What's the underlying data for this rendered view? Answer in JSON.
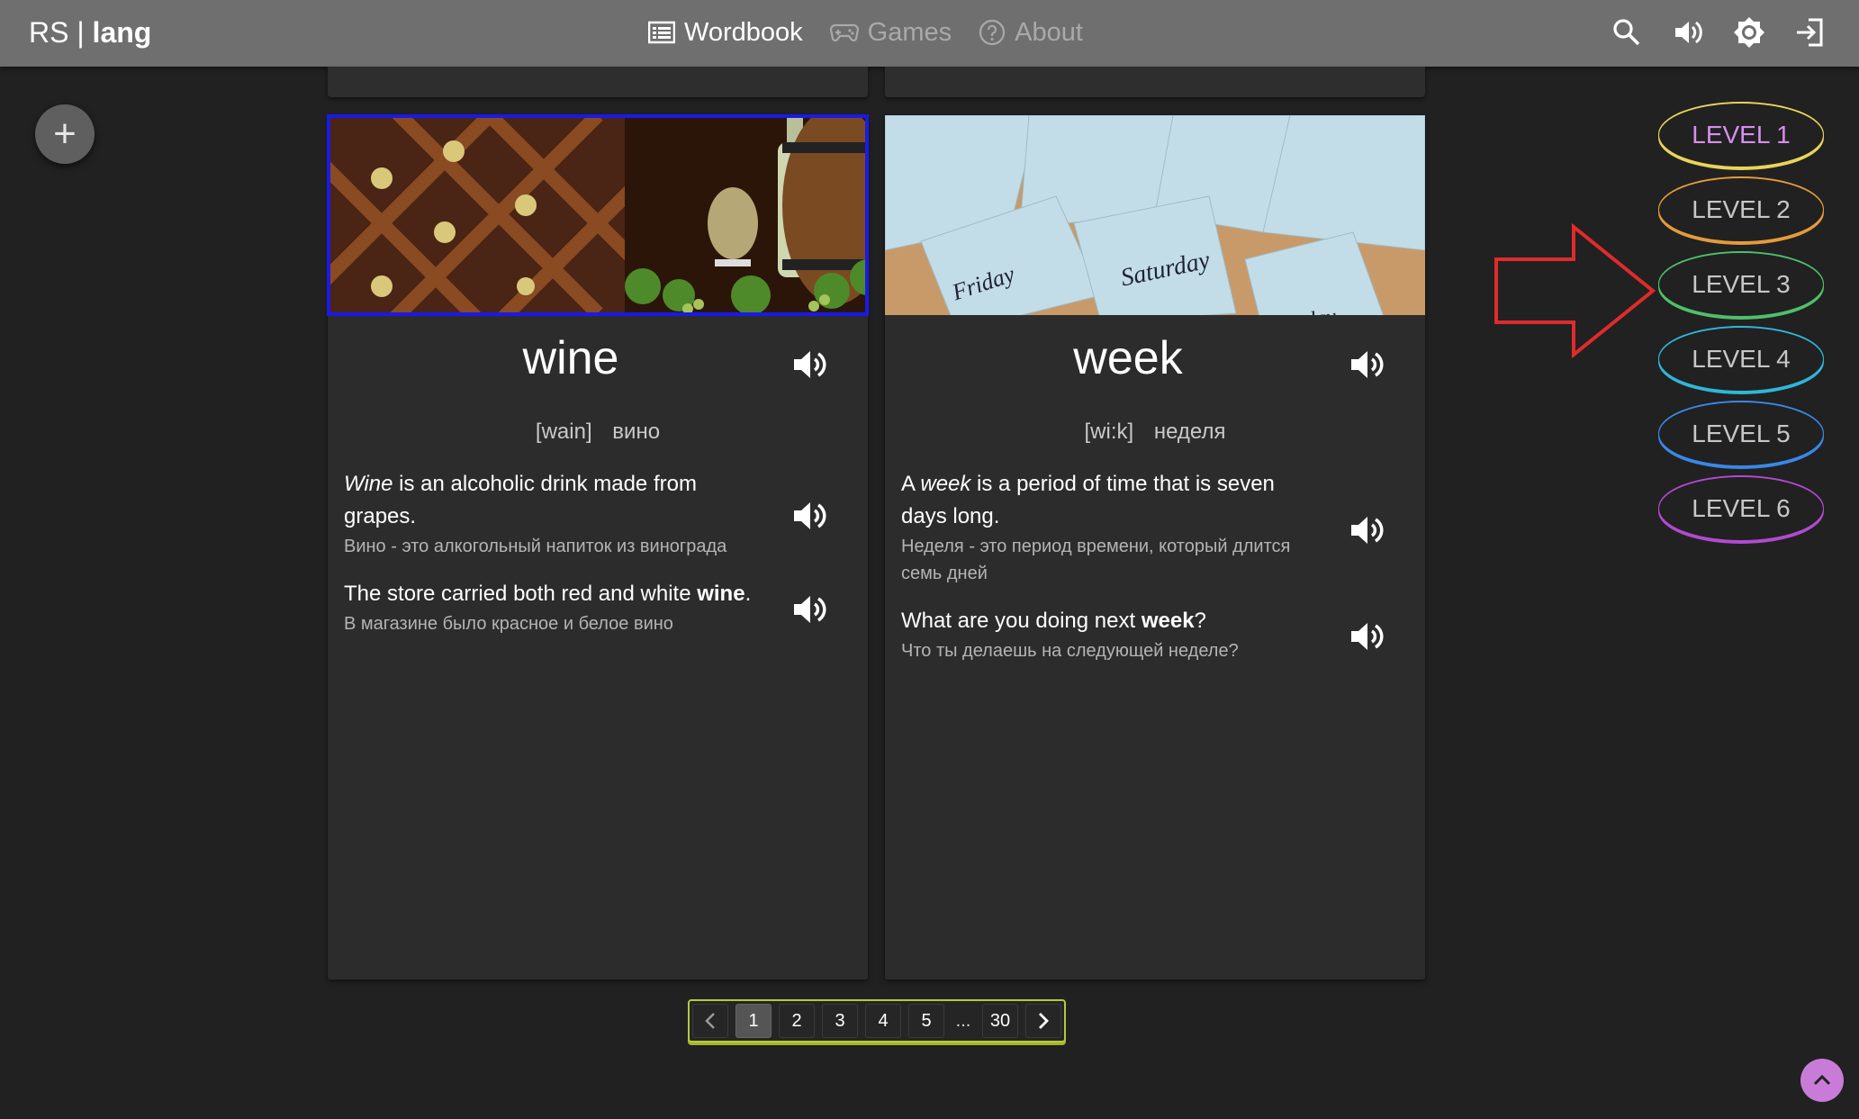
{
  "header": {
    "brand_left": "RS | ",
    "brand_right": "lang",
    "nav": [
      {
        "label": "Wordbook",
        "icon": "list-icon",
        "active": true
      },
      {
        "label": "Games",
        "icon": "gamepad-icon",
        "active": false
      },
      {
        "label": "About",
        "icon": "help-circle-icon",
        "active": false
      }
    ],
    "icons": [
      "search-icon",
      "volume-icon",
      "brightness-icon",
      "login-icon"
    ]
  },
  "add_button": {
    "label": "+"
  },
  "cards": [
    {
      "word": "wine",
      "transcription": "[wain]",
      "translation": "вино",
      "meaning_pre": "",
      "meaning_word": "Wine",
      "meaning_post": " is an alcoholic drink made from grapes.",
      "meaning_ru": "Вино - это алкогольный напиток из винограда",
      "example_pre": "The store carried both red and white ",
      "example_word": "wine",
      "example_post": ".",
      "example_ru": "В магазине было красное и белое вино",
      "selected": true
    },
    {
      "word": "week",
      "transcription": "[wi:k]",
      "translation": "неделя",
      "meaning_pre": "A ",
      "meaning_word": "week",
      "meaning_post": " is a period of time that is seven days long.",
      "meaning_ru": "Неделя - это период времени, который длится семь дней",
      "example_pre": "What are you doing next ",
      "example_word": "week",
      "example_post": "?",
      "example_ru": "Что ты делаешь на следующей неделе?",
      "selected": false,
      "image_words": [
        "Friday",
        "Saturday",
        "Sunday"
      ]
    }
  ],
  "levels": [
    {
      "label": "LEVEL 1",
      "color": "#e9d45a",
      "text_color": "#d98ef0"
    },
    {
      "label": "LEVEL 2",
      "color": "#e59b3b",
      "text_color": "#c7c7c7"
    },
    {
      "label": "LEVEL 3",
      "color": "#4fbf6b",
      "text_color": "#c7c7c7"
    },
    {
      "label": "LEVEL 4",
      "color": "#2fb7d8",
      "text_color": "#c7c7c7"
    },
    {
      "label": "LEVEL 5",
      "color": "#3a88e6",
      "text_color": "#c7c7c7"
    },
    {
      "label": "LEVEL 6",
      "color": "#b24ad0",
      "text_color": "#c7c7c7"
    }
  ],
  "pagination": {
    "pages": [
      "1",
      "2",
      "3",
      "4",
      "5",
      "...",
      "30"
    ],
    "current": "1"
  },
  "colors": {
    "header": "#6f6f6f",
    "background": "#212121",
    "card": "#2c2c2c",
    "annotation_arrow": "#e02b2b",
    "pager_border": "#b6c93b",
    "scroll_button": "#c87cd8"
  }
}
